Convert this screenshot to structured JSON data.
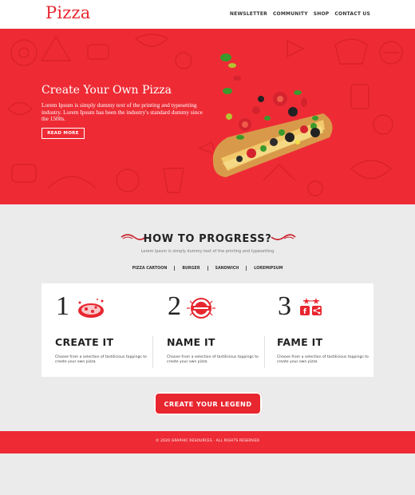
{
  "header": {
    "logo": "Pizza",
    "nav": [
      "NEWSLETTER",
      "COMMUNITY",
      "SHOP",
      "CONTACT US"
    ]
  },
  "hero": {
    "title": "Create Your Own Pizza",
    "text": "Lorem Ipsum is simply dummy text of the printing and typesetting industry. Lorem Ipsum has been the industry's standard dummy since the 1500s.",
    "button": "READ MORE"
  },
  "progress": {
    "title": "HOW TO PROGRESS?",
    "subtitle": "Lorem Ipsum is simply dummy text of the printing and typesetting",
    "tabs": [
      "PIZZA CARTOON",
      "BURGER",
      "SANDWICH",
      "LOREMIPSUM"
    ]
  },
  "cards": [
    {
      "number": "1",
      "title": "CREATE IT",
      "desc": "Choose from a selection of tastilicious toppings to create your own pizza",
      "icon": "pizza-icon"
    },
    {
      "number": "2",
      "title": "NAME IT",
      "desc": "Choose from a selection of tastilicious toppings to create your own pizza",
      "icon": "name-badge-icon"
    },
    {
      "number": "3",
      "title": "FAME IT",
      "desc": "Choose from a selection of tastilicious toppings to create your own pizza",
      "icon": "social-share-icon"
    }
  ],
  "cta": "CREATE YOUR LEGEND",
  "footer": "© 2020 GRAPHIC RESOURCES · ALL RIGHTS RESERVED",
  "colors": {
    "brand_red": "#ee2b35",
    "logo_red": "#e8262f",
    "section_bg": "#ebebeb"
  }
}
